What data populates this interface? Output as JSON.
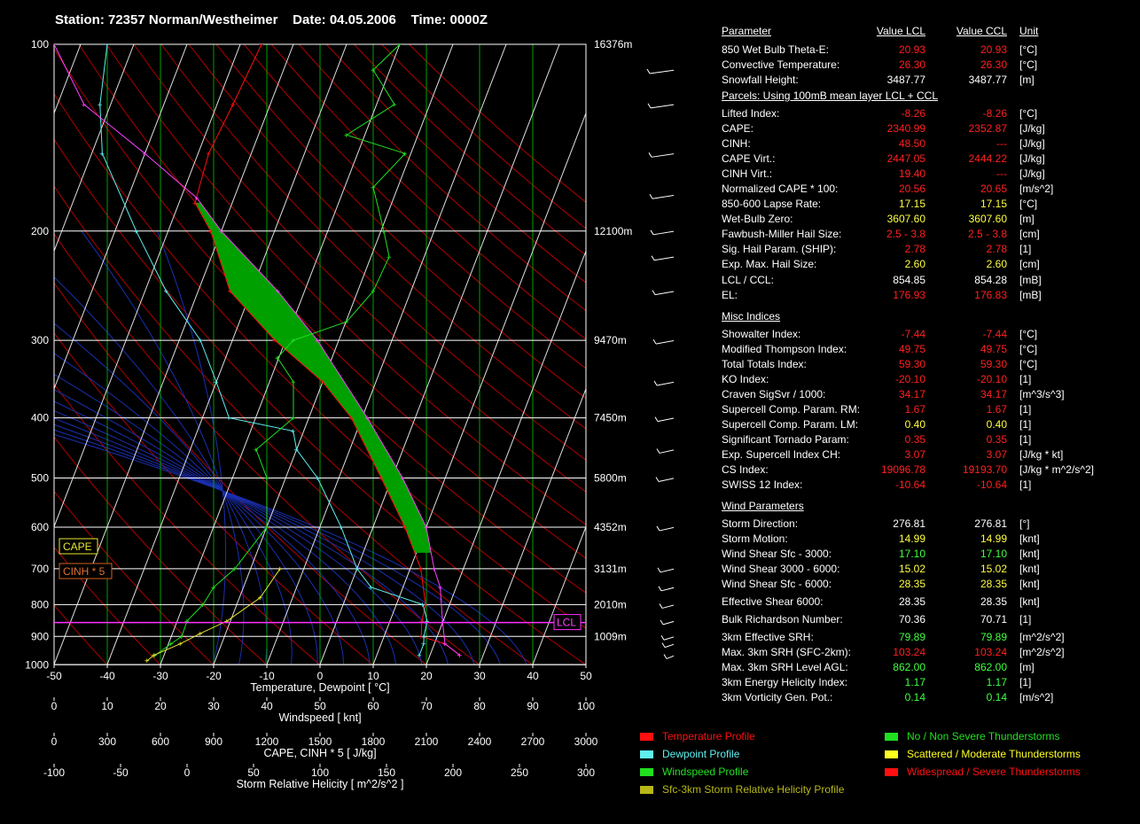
{
  "header": {
    "station": "Station: 72357 Norman/Westheimer",
    "date": "Date: 04.05.2006",
    "time": "Time: 0000Z"
  },
  "chart_data": {
    "type": "line",
    "title": "Station: 72357 Norman/Westheimer    Date: 04.05.2006    Time: 0000Z",
    "xlabel": "Temperature, Dewpoint  [ °C]",
    "xlim": [
      -50,
      50
    ],
    "x_ticks": [
      "-50",
      "-40",
      "-30",
      "-20",
      "-10",
      "0",
      "10",
      "20",
      "30",
      "40",
      "50"
    ],
    "pressure_levels": [
      "100",
      "200",
      "300",
      "400",
      "500",
      "600",
      "700",
      "800",
      "900",
      "1000"
    ],
    "height_labels": [
      {
        "p": 100,
        "label": "16376m"
      },
      {
        "p": 200,
        "label": "12100m"
      },
      {
        "p": 300,
        "label": "9470m"
      },
      {
        "p": 400,
        "label": "7450m"
      },
      {
        "p": 500,
        "label": "5800m"
      },
      {
        "p": 600,
        "label": "4352m"
      },
      {
        "p": 700,
        "label": "3131m"
      },
      {
        "p": 800,
        "label": "2010m"
      },
      {
        "p": 900,
        "label": "1009m"
      }
    ],
    "ylim": [
      1050,
      100
    ],
    "yscale": "log",
    "lcl_pressure": 854.85,
    "el_pressure": 176.93,
    "box_labels": {
      "cape": "CAPE",
      "cinh": "CINH * 5",
      "lcl": "LCL"
    },
    "series": [
      {
        "name": "Temperature Profile",
        "color": "#ff1010",
        "points": [
          [
            25.6,
            965
          ],
          [
            22,
            925
          ],
          [
            17,
            900
          ],
          [
            16,
            850
          ],
          [
            15.5,
            800
          ],
          [
            12,
            700
          ],
          [
            6,
            600
          ],
          [
            -2,
            500
          ],
          [
            -12,
            400
          ],
          [
            -20,
            350
          ],
          [
            -32,
            300
          ],
          [
            -44,
            250
          ],
          [
            -52,
            200
          ],
          [
            -57,
            180
          ],
          [
            -58,
            150
          ],
          [
            -57,
            125
          ],
          [
            -56,
            100
          ]
        ]
      },
      {
        "name": "Dewpoint Profile",
        "color": "#5ff0f0",
        "points": [
          [
            18,
            965
          ],
          [
            18,
            925
          ],
          [
            17.5,
            900
          ],
          [
            17,
            850
          ],
          [
            15,
            800
          ],
          [
            4,
            750
          ],
          [
            0,
            700
          ],
          [
            -6,
            600
          ],
          [
            -14,
            500
          ],
          [
            -20,
            450
          ],
          [
            -22,
            420
          ],
          [
            -35,
            400
          ],
          [
            -40,
            350
          ],
          [
            -46,
            300
          ],
          [
            -56,
            250
          ],
          [
            -66,
            200
          ],
          [
            -78,
            150
          ],
          [
            -82,
            125
          ],
          [
            -85,
            100
          ]
        ]
      },
      {
        "name": "Parcel",
        "color": "#ff40ff",
        "points": [
          [
            25.6,
            965
          ],
          [
            22,
            925
          ],
          [
            20,
            854.85
          ],
          [
            17,
            750
          ],
          [
            14.5,
            700
          ],
          [
            10,
            600
          ],
          [
            2,
            500
          ],
          [
            -9,
            400
          ],
          [
            -24,
            300
          ],
          [
            -35,
            250
          ],
          [
            -50,
            200
          ],
          [
            -57,
            176.93
          ],
          [
            -70,
            150
          ],
          [
            -85,
            125
          ],
          [
            -95,
            100
          ]
        ]
      },
      {
        "name": "Windspeed Profile",
        "color": "#20e020",
        "xscale": "windspeed",
        "points": [
          [
            19,
            965
          ],
          [
            22,
            925
          ],
          [
            24,
            900
          ],
          [
            25,
            850
          ],
          [
            28,
            800
          ],
          [
            30,
            750
          ],
          [
            34,
            700
          ],
          [
            40,
            600
          ],
          [
            40,
            500
          ],
          [
            38,
            450
          ],
          [
            45,
            400
          ],
          [
            45,
            350
          ],
          [
            42,
            320
          ],
          [
            45,
            300
          ],
          [
            55,
            280
          ],
          [
            60,
            250
          ],
          [
            63,
            220
          ],
          [
            62,
            200
          ],
          [
            60,
            170
          ],
          [
            66,
            150
          ],
          [
            55,
            140
          ],
          [
            64,
            125
          ],
          [
            60,
            110
          ],
          [
            65,
            100
          ]
        ]
      },
      {
        "name": "Sfc-3km Storm Relative Helicity Profile",
        "color": "#e6e630",
        "xscale": "helicity",
        "points": [
          [
            -30,
            985
          ],
          [
            -25,
            965
          ],
          [
            -5,
            925
          ],
          [
            10,
            890
          ],
          [
            30,
            850
          ],
          [
            55,
            780
          ],
          [
            70,
            700
          ]
        ]
      }
    ],
    "xaxes": [
      {
        "name": "windspeed",
        "label": "Windspeed  [ knt]",
        "range": [
          0,
          100
        ],
        "ticks": [
          "0",
          "10",
          "20",
          "30",
          "40",
          "50",
          "60",
          "70",
          "80",
          "90",
          "100"
        ]
      },
      {
        "name": "cape",
        "label": "CAPE, CINH * 5  [ J/kg]",
        "range": [
          0,
          3000
        ],
        "ticks": [
          "0",
          "300",
          "600",
          "900",
          "1200",
          "1500",
          "1800",
          "2100",
          "2400",
          "2700",
          "3000"
        ]
      },
      {
        "name": "helicity",
        "label": "Storm Relative Helicity  [ m^2/s^2 ]",
        "range": [
          -100,
          300
        ],
        "ticks": [
          "-100",
          "-50",
          "0",
          "50",
          "100",
          "150",
          "200",
          "250",
          "300"
        ]
      }
    ],
    "wind_barbs": [
      [
        965,
        170,
        10
      ],
      [
        925,
        200,
        20
      ],
      [
        900,
        215,
        25
      ],
      [
        850,
        220,
        30
      ],
      [
        800,
        225,
        35
      ],
      [
        750,
        230,
        40
      ],
      [
        700,
        240,
        45
      ],
      [
        600,
        250,
        50
      ],
      [
        500,
        255,
        55
      ],
      [
        450,
        250,
        50
      ],
      [
        400,
        255,
        60
      ],
      [
        350,
        255,
        65
      ],
      [
        300,
        260,
        70
      ],
      [
        250,
        255,
        75
      ],
      [
        220,
        250,
        80
      ],
      [
        200,
        250,
        85
      ],
      [
        175,
        255,
        90
      ],
      [
        150,
        250,
        95
      ],
      [
        125,
        255,
        100
      ],
      [
        110,
        250,
        105
      ]
    ]
  },
  "table": {
    "header": {
      "param": "Parameter",
      "lcl": "Value LCL",
      "ccl": "Value CCL",
      "unit": "Unit"
    },
    "rows_a": [
      {
        "p": "850 Wet Bulb Theta-E:",
        "lcl": "20.93",
        "ccl": "20.93",
        "u": "[°C]",
        "color": "#ff2020"
      },
      {
        "p": "Convective Temperature:",
        "lcl": "26.30",
        "ccl": "26.30",
        "u": "[°C]",
        "color": "#ff2020"
      },
      {
        "p": "Snowfall Height:",
        "lcl": "3487.77",
        "ccl": "3487.77",
        "u": "[m]",
        "color": "#ffffff"
      }
    ],
    "section_parcels": "Parcels: Using 100mB mean layer LCL + CCL",
    "rows_b": [
      {
        "p": "Lifted Index:",
        "lcl": "-8.26",
        "ccl": "-8.26",
        "u": "[°C]",
        "color": "#ff2020"
      },
      {
        "p": "CAPE:",
        "lcl": "2340.99",
        "ccl": "2352.87",
        "u": "[J/kg]",
        "color": "#ff2020"
      },
      {
        "p": "CINH:",
        "lcl": "48.50",
        "ccl": "---",
        "u": "[J/kg]",
        "color": "#ff2020"
      },
      {
        "p": "CAPE Virt.:",
        "lcl": "2447.05",
        "ccl": "2444.22",
        "u": "[J/kg]",
        "color": "#ff2020"
      },
      {
        "p": "CINH Virt.:",
        "lcl": "19.40",
        "ccl": "---",
        "u": "[J/kg]",
        "color": "#ff2020"
      },
      {
        "p": "Normalized CAPE * 100:",
        "lcl": "20.56",
        "ccl": "20.65",
        "u": "[m/s^2]",
        "color": "#ff2020"
      },
      {
        "p": "850-600 Lapse Rate:",
        "lcl": "17.15",
        "ccl": "17.15",
        "u": "[°C]",
        "color": "#ffff40"
      },
      {
        "p": "Wet-Bulb Zero:",
        "lcl": "3607.60",
        "ccl": "3607.60",
        "u": "[m]",
        "color": "#ffff40"
      },
      {
        "p": "Fawbush-Miller Hail Size:",
        "lcl": "2.5 - 3.8",
        "ccl": "2.5 - 3.8",
        "u": "[cm]",
        "color": "#ff2020"
      },
      {
        "p": "Sig. Hail Param. (SHIP):",
        "lcl": "2.78",
        "ccl": "2.78",
        "u": "[1]",
        "color": "#ff2020"
      },
      {
        "p": "Exp. Max. Hail Size:",
        "lcl": "2.60",
        "ccl": "2.60",
        "u": "[cm]",
        "color": "#ffff40"
      },
      {
        "p": "LCL / CCL:",
        "lcl": "854.85",
        "ccl": "854.28",
        "u": "[mB]",
        "color": "#ffffff"
      },
      {
        "p": "EL:",
        "lcl": "176.93",
        "ccl": "176.83",
        "u": "[mB]",
        "color": "#ff2020"
      }
    ],
    "section_misc": "Misc Indices",
    "rows_c": [
      {
        "p": "Showalter Index:",
        "lcl": "-7.44",
        "ccl": "-7.44",
        "u": "[°C]",
        "color": "#ff2020"
      },
      {
        "p": "Modified Thompson Index:",
        "lcl": "49.75",
        "ccl": "49.75",
        "u": "[°C]",
        "color": "#ff2020"
      },
      {
        "p": "Total Totals Index:",
        "lcl": "59.30",
        "ccl": "59.30",
        "u": "[°C]",
        "color": "#ff2020"
      },
      {
        "p": "KO Index:",
        "lcl": "-20.10",
        "ccl": "-20.10",
        "u": "[1]",
        "color": "#ff2020"
      },
      {
        "p": "Craven SigSvr / 1000:",
        "lcl": "34.17",
        "ccl": "34.17",
        "u": "[m^3/s^3]",
        "color": "#ff2020"
      },
      {
        "p": "Supercell Comp. Param. RM:",
        "lcl": "1.67",
        "ccl": "1.67",
        "u": "[1]",
        "color": "#ff2020"
      },
      {
        "p": "Supercell Comp. Param. LM:",
        "lcl": "0.40",
        "ccl": "0.40",
        "u": "[1]",
        "color": "#ffff40"
      },
      {
        "p": "Significant Tornado Param:",
        "lcl": "0.35",
        "ccl": "0.35",
        "u": "[1]",
        "color": "#ff2020"
      },
      {
        "p": "Exp. Supercell Index CH:",
        "lcl": "3.07",
        "ccl": "3.07",
        "u": "[J/kg * kt]",
        "color": "#ff2020"
      },
      {
        "p": "CS Index:",
        "lcl": "19096.78",
        "ccl": "19193.70",
        "u": "[J/kg * m^2/s^2]",
        "color": "#ff2020"
      },
      {
        "p": "SWISS 12 Index:",
        "lcl": "-10.64",
        "ccl": "-10.64",
        "u": "[1]",
        "color": "#ff2020"
      }
    ],
    "section_wind": "Wind Parameters",
    "rows_d": [
      {
        "p": "Storm Direction:",
        "lcl": "276.81",
        "ccl": "276.81",
        "u": "[°]",
        "color": "#ffffff"
      },
      {
        "p": "Storm Motion:",
        "lcl": "14.99",
        "ccl": "14.99",
        "u": "[knt]",
        "color": "#ffff40"
      },
      {
        "p": "Wind Shear Sfc - 3000:",
        "lcl": "17.10",
        "ccl": "17.10",
        "u": "[knt]",
        "color": "#40ff40"
      },
      {
        "p": "Wind Shear 3000 - 6000:",
        "lcl": "15.02",
        "ccl": "15.02",
        "u": "[knt]",
        "color": "#ffff40"
      },
      {
        "p": "Wind Shear Sfc - 6000:",
        "lcl": "28.35",
        "ccl": "28.35",
        "u": "[knt]",
        "color": "#ffff40"
      },
      {
        "p": "Effective Shear 6000:",
        "lcl": "28.35",
        "ccl": "28.35",
        "u": "[knt]",
        "color": "#ffffff"
      },
      {
        "p": "Bulk Richardson Number:",
        "lcl": "70.36",
        "ccl": "70.71",
        "u": "[1]",
        "color": "#ffffff"
      },
      {
        "p": "3km Effective SRH:",
        "lcl": "79.89",
        "ccl": "79.89",
        "u": "[m^2/s^2]",
        "color": "#40ff40"
      },
      {
        "p": "Max. 3km SRH (SFC-2km):",
        "lcl": "103.24",
        "ccl": "103.24",
        "u": "[m^2/s^2]",
        "color": "#ff2020"
      },
      {
        "p": "Max. 3km SRH Level AGL:",
        "lcl": "862.00",
        "ccl": "862.00",
        "u": "[m]",
        "color": "#40ff40"
      },
      {
        "p": "3km Energy Helicity Index:",
        "lcl": "1.17",
        "ccl": "1.17",
        "u": "[1]",
        "color": "#40ff40"
      },
      {
        "p": "3km Vorticity Gen. Pot.:",
        "lcl": "0.14",
        "ccl": "0.14",
        "u": "[m/s^2]",
        "color": "#40ff40"
      }
    ]
  },
  "legend_profiles": [
    {
      "label": "Temperature Profile",
      "color": "#ff1010"
    },
    {
      "label": "Dewpoint Profile",
      "color": "#5ff0f0"
    },
    {
      "label": "Windspeed Profile",
      "color": "#20e020"
    },
    {
      "label": "Sfc-3km Storm Relative Helicity Profile",
      "color": "#b8b818"
    }
  ],
  "legend_severity": [
    {
      "label": "No / Non Severe Thunderstorms",
      "color": "#20e020"
    },
    {
      "label": "Scattered / Moderate Thunderstorms",
      "color": "#ffff20"
    },
    {
      "label": "Widespread / Severe Thunderstorms",
      "color": "#ff1010"
    }
  ]
}
